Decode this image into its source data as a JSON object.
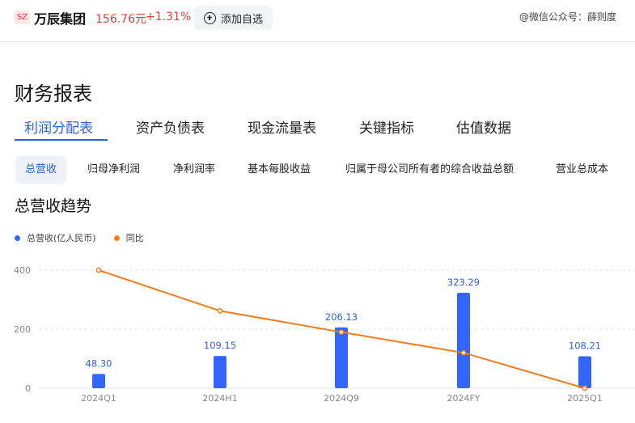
{
  "stock": {
    "market_badge": "SZ",
    "name": "万辰集团",
    "price": "156.76元",
    "change": "+1.31%",
    "add_watch_label": "添加自选",
    "up_color": "#e03c3c"
  },
  "watermark": "@微信公众号：薛则度",
  "section_title": "财务报表",
  "main_tabs": [
    {
      "label": "利润分配表",
      "active": true
    },
    {
      "label": "资产负债表",
      "active": false
    },
    {
      "label": "现金流量表",
      "active": false
    },
    {
      "label": "关键指标",
      "active": false
    },
    {
      "label": "估值数据",
      "active": false
    }
  ],
  "sub_tabs": [
    {
      "label": "总营收",
      "active": true
    },
    {
      "label": "归母净利润",
      "active": false
    },
    {
      "label": "净利润率",
      "active": false
    },
    {
      "label": "基本每股收益",
      "active": false
    },
    {
      "label": "归属于母公司所有者的综合收益总额",
      "active": false
    },
    {
      "label": "营业总成本",
      "active": false
    }
  ],
  "chart_title": "总营收趋势",
  "legend": {
    "revenue": "总营收(亿人民币)",
    "yoy": "同比"
  },
  "colors": {
    "bar": "#3366ff",
    "line": "#f07c1e",
    "accent": "#2f5fd9"
  },
  "chart_data": {
    "type": "bar",
    "categories": [
      "2024Q1",
      "2024H1",
      "2024Q9",
      "2024FY",
      "2025Q1"
    ],
    "series": [
      {
        "name": "总营收(亿人民币)",
        "type": "bar",
        "values": [
          48.3,
          109.15,
          206.13,
          323.29,
          108.21
        ],
        "labels": [
          "48.30",
          "109.15",
          "206.13",
          "323.29",
          "108.21"
        ]
      },
      {
        "name": "同比",
        "type": "line",
        "values": [
          400,
          262,
          190,
          120,
          0
        ]
      }
    ],
    "y_ticks": [
      "0",
      "200",
      "400"
    ],
    "ylim": [
      0,
      400
    ],
    "grid": true,
    "legend_position": "top-left"
  }
}
